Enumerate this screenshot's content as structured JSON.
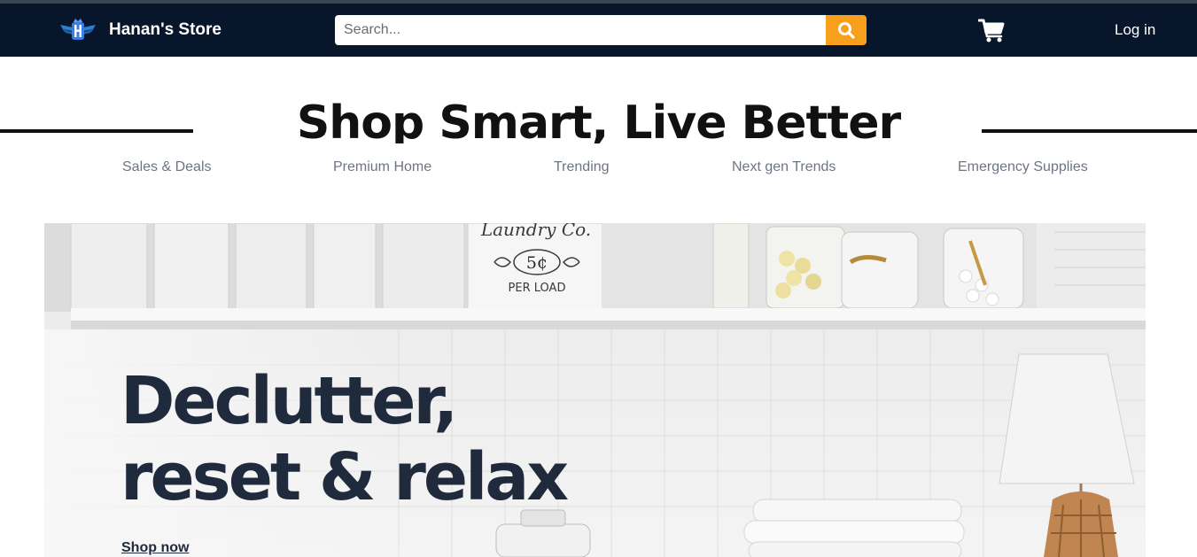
{
  "navbar": {
    "brand_name": "Hanan's Store",
    "logo_icon": "winged-h-logo",
    "search_placeholder": "Search...",
    "search_icon": "search-icon",
    "cart_icon": "cart-icon",
    "login_label": "Log in",
    "colors": {
      "background": "#08162b",
      "search_button": "#f8a01c"
    }
  },
  "headline": "Shop Smart, Live Better",
  "categories": [
    "Sales & Deals",
    "Premium Home",
    "Trending",
    "Next gen Trends",
    "Emergency Supplies"
  ],
  "hero": {
    "title_line1": "Declutter,",
    "title_line2": "reset & relax",
    "cta_label": "Shop now",
    "jar_label_brand": "Laundry Co.",
    "jar_label_price": "5¢",
    "jar_label_unit": "PER LOAD"
  }
}
